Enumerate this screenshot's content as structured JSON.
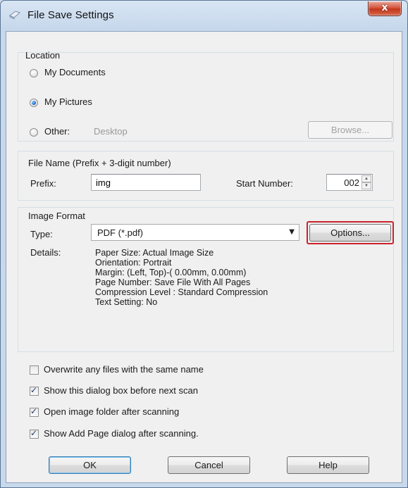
{
  "window": {
    "title": "File Save Settings",
    "close_label": "x"
  },
  "location": {
    "group_label": "Location",
    "options": [
      {
        "label": "My Documents",
        "checked": false
      },
      {
        "label": "My Pictures",
        "checked": true
      },
      {
        "label": "Other:",
        "checked": false
      }
    ],
    "other_value": "Desktop",
    "browse_label": "Browse..."
  },
  "file_name": {
    "group_label": "File Name (Prefix + 3-digit number)",
    "prefix_label": "Prefix:",
    "prefix_value": "img",
    "start_number_label": "Start Number:",
    "start_number_value": "002"
  },
  "image_format": {
    "group_label": "Image Format",
    "type_label": "Type:",
    "type_value": "PDF (*.pdf)",
    "options_label": "Options...",
    "details_label": "Details:",
    "details": [
      "Paper Size: Actual Image Size",
      "Orientation: Portrait",
      "Margin: (Left, Top)-( 0.00mm, 0.00mm)",
      "Page Number: Save File With All Pages",
      "Compression Level : Standard Compression",
      "Text Setting: No"
    ]
  },
  "checkboxes": [
    {
      "label": "Overwrite any files with the same name",
      "checked": false
    },
    {
      "label": "Show this dialog box before next scan",
      "checked": true
    },
    {
      "label": "Open image folder after scanning",
      "checked": true
    },
    {
      "label": "Show Add Page dialog after scanning.",
      "checked": true
    }
  ],
  "buttons": {
    "ok": "OK",
    "cancel": "Cancel",
    "help": "Help"
  },
  "colors": {
    "highlight": "#c8232c",
    "accent": "#1e6fc2"
  }
}
